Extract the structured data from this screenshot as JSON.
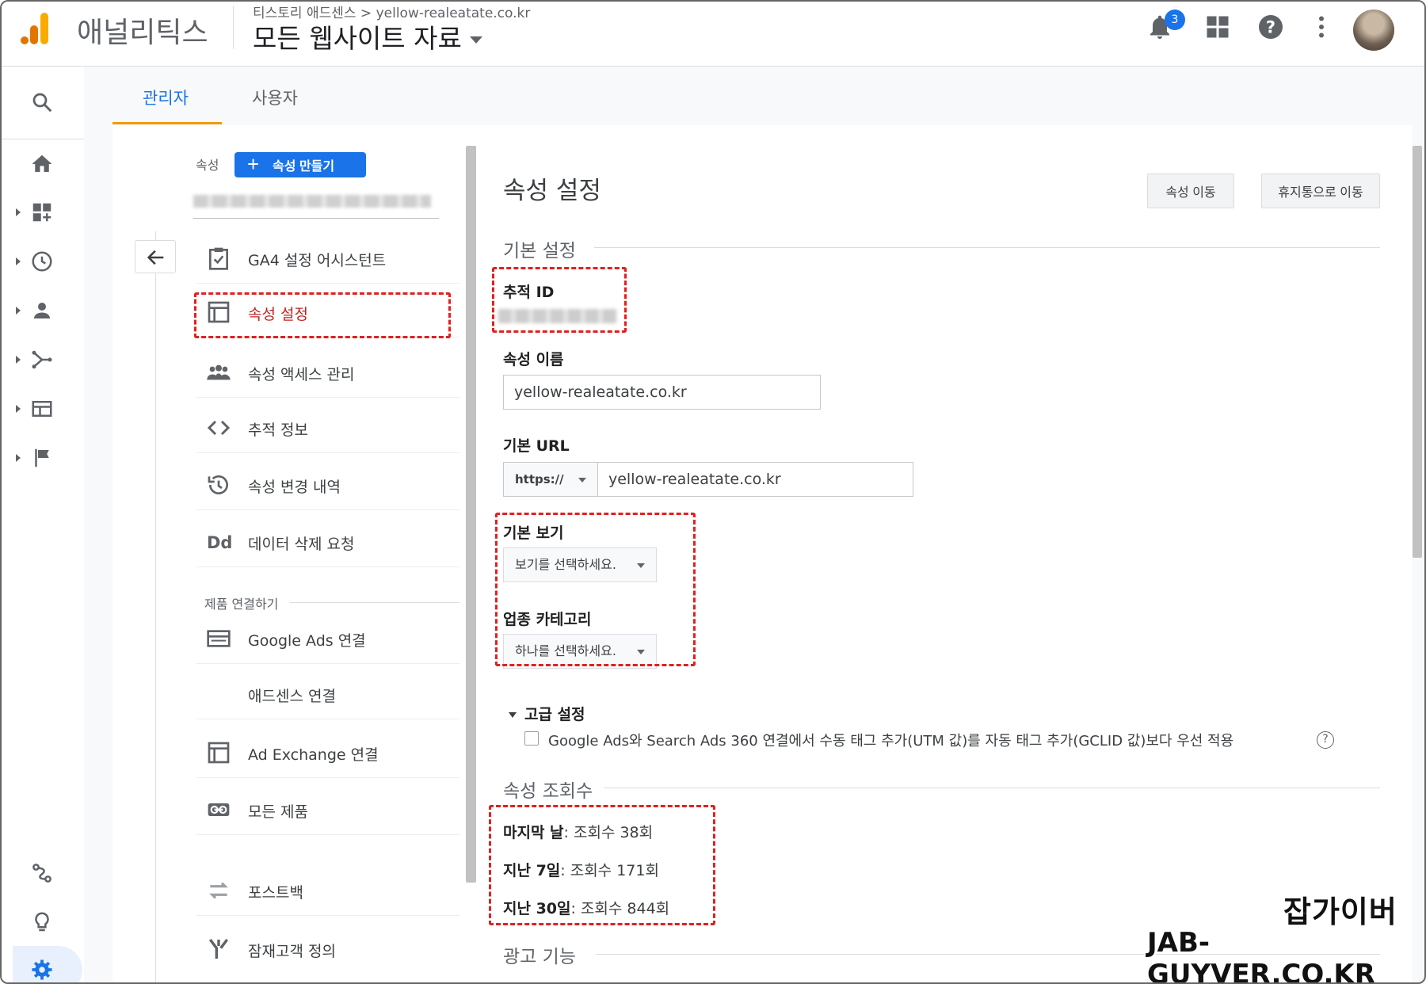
{
  "header": {
    "app_name": "애널리틱스",
    "breadcrumb": "티스토리 애드센스 > yellow-realeatate.co.kr",
    "account_title": "모든 웹사이트 자료",
    "notification_count": "3",
    "brand_colors": {
      "bar1": "#f9ab00",
      "bar2": "#e37400",
      "bar3": "#e37400"
    }
  },
  "rail": {
    "icons": [
      "search-icon",
      "home-icon",
      "dashboard-icon",
      "clock-icon",
      "person-icon",
      "acquisition-icon",
      "behavior-icon",
      "flag-icon",
      "connect-icon",
      "lightbulb-icon",
      "gear-icon"
    ]
  },
  "tabs": [
    {
      "label": "관리자",
      "active": true
    },
    {
      "label": "사용자",
      "active": false
    }
  ],
  "property_nav": {
    "section_label": "속성",
    "create_button": "속성 만들기",
    "items": [
      {
        "label": "GA4 설정 어시스턴트",
        "icon": "clipboard-check-icon"
      },
      {
        "label": "속성 설정",
        "icon": "layout-icon",
        "selected": true
      },
      {
        "label": "속성 액세스 관리",
        "icon": "people-icon"
      },
      {
        "label": "추적 정보",
        "icon": "code-icon"
      },
      {
        "label": "속성 변경 내역",
        "icon": "history-icon"
      },
      {
        "label": "데이터 삭제 요청",
        "icon": "dd-icon"
      }
    ],
    "product_section": "제품 연결하기",
    "product_items": [
      {
        "label": "Google Ads 연결",
        "icon": "ads-icon"
      },
      {
        "label": "애드센스 연결",
        "icon": ""
      },
      {
        "label": "Ad Exchange 연결",
        "icon": "layout-icon"
      },
      {
        "label": "모든 제품",
        "icon": "link-icon"
      },
      {
        "label": "포스트백",
        "icon": "swap-icon"
      },
      {
        "label": "잠재고객 정의",
        "icon": "fork-icon"
      }
    ]
  },
  "settings": {
    "title": "속성 설정",
    "move_button": "속성 이동",
    "trash_button": "휴지통으로 이동",
    "basic_section": "기본 설정",
    "tracking_id_label": "추적 ID",
    "property_name_label": "속성 이름",
    "property_name_value": "yellow-realeatate.co.kr",
    "default_url_label": "기본 URL",
    "protocol_value": "https://",
    "default_url_value": "yellow-realeatate.co.kr",
    "default_view_label": "기본 보기",
    "default_view_value": "보기를 선택하세요.",
    "industry_label": "업종 카테고리",
    "industry_value": "하나를 선택하세요.",
    "advanced_label": "고급 설정",
    "advanced_checkbox": "Google Ads와 Search Ads 360 연결에서 수동 태그 추가(UTM 값)를 자동 태그 추가(GCLID 값)보다 우선 적용",
    "advanced_checked": false,
    "views_section": "속성 조회수",
    "stats": [
      {
        "label": "마지막 날",
        "value": ": 조회수 38회"
      },
      {
        "label": "지난 7일",
        "value": ": 조회수 171회"
      },
      {
        "label": "지난 30일",
        "value": ": 조회수 844회"
      }
    ],
    "ads_section": "광고 기능"
  },
  "watermark": {
    "line1": "잡가이버",
    "line2": "JAB-GUYVER.CO.KR"
  },
  "accent_colors": {
    "primary": "#1a73e8",
    "tab_underline": "#f29900",
    "highlight": "#e02020"
  }
}
